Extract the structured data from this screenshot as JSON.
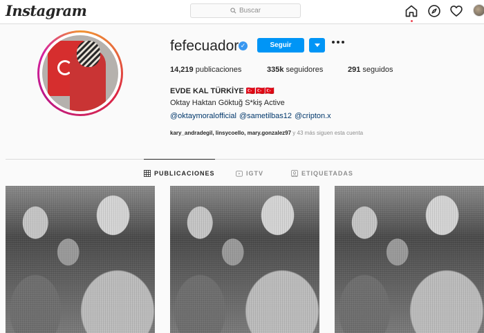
{
  "nav": {
    "logo": "Instagram",
    "search_placeholder": "Buscar",
    "icons": [
      "home-icon",
      "explore-icon",
      "heart-icon",
      "profile-avatar"
    ]
  },
  "profile": {
    "username": "fefecuador",
    "verified": true,
    "follow_label": "Seguir",
    "stats": {
      "posts_count": "14,219",
      "posts_label": "publicaciones",
      "followers_count": "335k",
      "followers_label": "seguidores",
      "following_count": "291",
      "following_label": "seguidos"
    },
    "full_name": "EVDE KAL TÜRKİYE 🇹🇷🇹🇷🇹🇷",
    "bio": "Oktay Haktan Göktuğ S*kiş Active",
    "mentions": [
      "@oktaymoralofficial",
      "@sametilbas12",
      "@cripton.x"
    ],
    "followed_by_names": "kary_andradegil, linsycoello, mary.gonzalez97",
    "followed_by_suffix": " y 43 más siguen esta cuenta"
  },
  "tabs": [
    {
      "label": "PUBLICACIONES",
      "icon": "grid-icon",
      "active": true
    },
    {
      "label": "IGTV",
      "icon": "igtv-icon",
      "active": false
    },
    {
      "label": "ETIQUETADAS",
      "icon": "tagged-icon",
      "active": false
    }
  ],
  "colors": {
    "accent": "#0095f6",
    "verified": "#3897f0",
    "link": "#00376b",
    "notification_dot": "#ed4956"
  }
}
